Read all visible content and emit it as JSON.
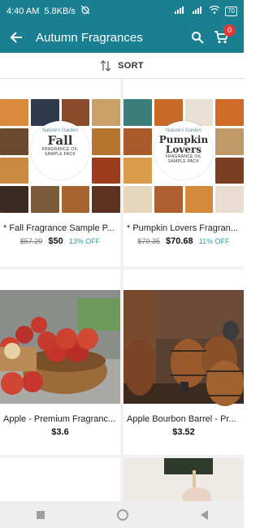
{
  "status": {
    "time": "4:40 AM",
    "speed": "5.8KB/s",
    "battery": "70"
  },
  "app": {
    "title": "Autumn Fragrances",
    "cart_count": "0"
  },
  "sort": {
    "label": "SORT"
  },
  "products": [
    {
      "name": "* Fall Fragrance Sample P...",
      "old_price": "$57.29",
      "price": "$50",
      "discount": "13% OFF",
      "emblem_brand": "Nature's Garden",
      "emblem_title": "Fall",
      "emblem_line1": "FRAGRANCE OIL",
      "emblem_line2": "SAMPLE PACK"
    },
    {
      "name": "* Pumpkin Lovers Fragran...",
      "old_price": "$79.35",
      "price": "$70.68",
      "discount": "11% OFF",
      "emblem_brand": "Nature's Garden",
      "emblem_title": "Pumpkin Lovers",
      "emblem_line1": "FRAGRANCE OIL",
      "emblem_line2": "SAMPLE PACK"
    },
    {
      "name": "Apple - Premium Fragranc...",
      "price": "$3.6"
    },
    {
      "name": "Apple Bourbon Barrel - Pr...",
      "price": "$3.52"
    }
  ]
}
